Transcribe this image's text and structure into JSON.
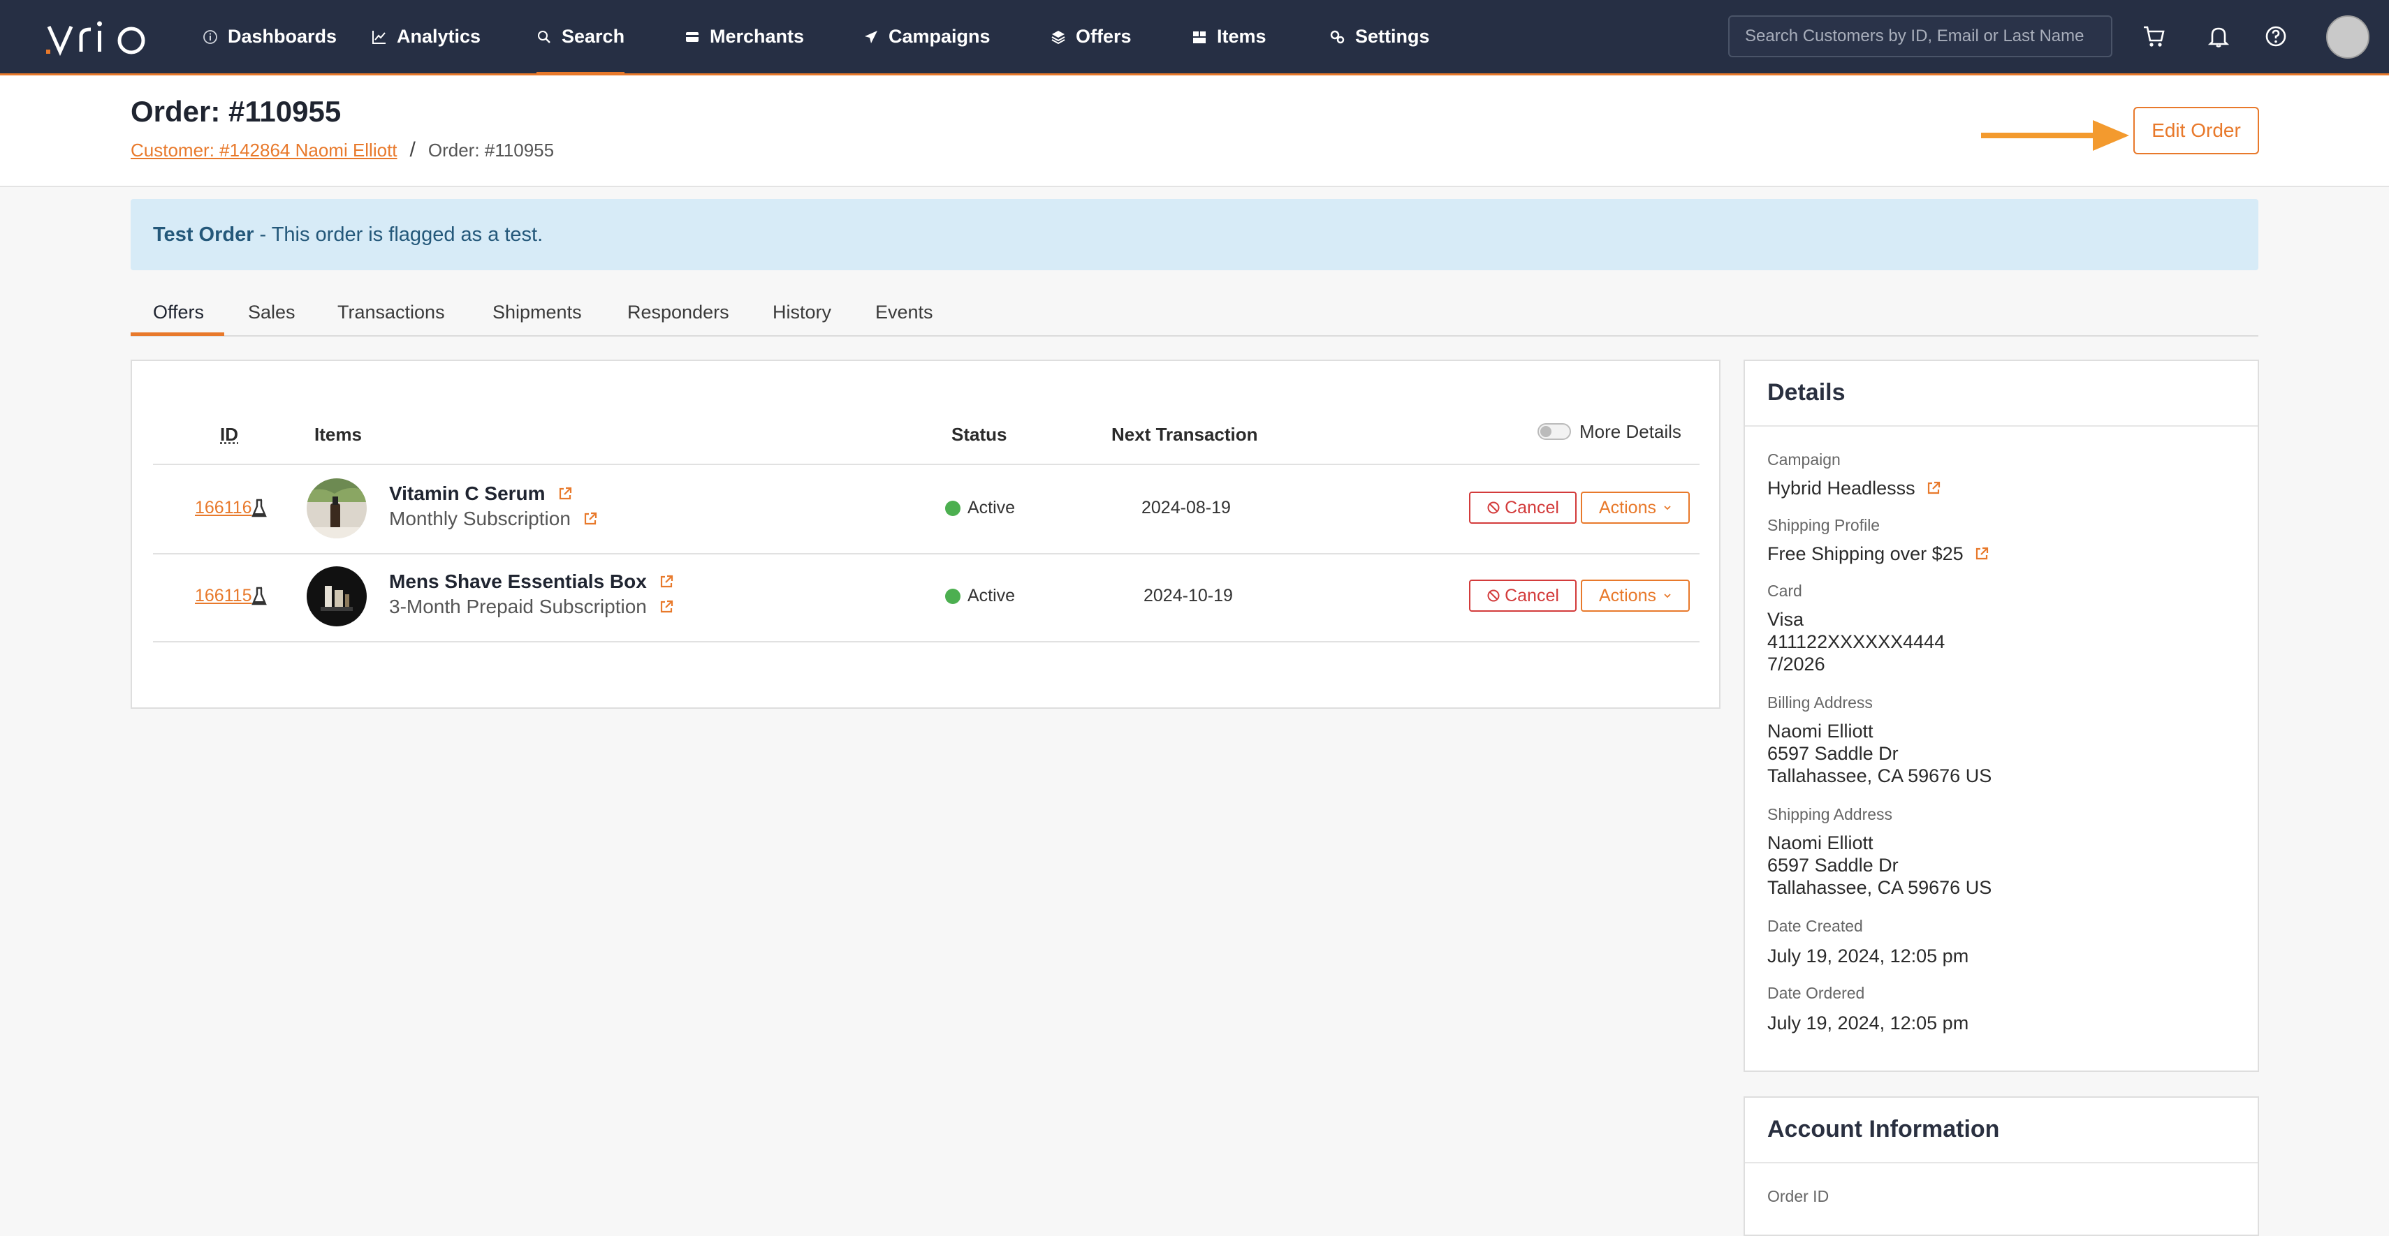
{
  "nav": {
    "logo": "vrio",
    "items": [
      {
        "label": "Dashboards",
        "icon": "info-circle-icon"
      },
      {
        "label": "Analytics",
        "icon": "line-chart-icon"
      },
      {
        "label": "Search",
        "icon": "search-icon"
      },
      {
        "label": "Merchants",
        "icon": "credit-card-icon"
      },
      {
        "label": "Campaigns",
        "icon": "send-icon"
      },
      {
        "label": "Offers",
        "icon": "layers-icon"
      },
      {
        "label": "Items",
        "icon": "boxes-icon"
      },
      {
        "label": "Settings",
        "icon": "cogs-icon"
      }
    ],
    "active": "Search",
    "search_placeholder": "Search Customers by ID, Email or Last Name"
  },
  "header": {
    "title": "Order: #110955",
    "breadcrumb_customer": "Customer: #142864 Naomi Elliott",
    "breadcrumb_sep": "/",
    "breadcrumb_order": "Order: #110955",
    "edit_button": "Edit Order"
  },
  "alert": {
    "bold": "Test Order",
    "text": "- This order is flagged as a test."
  },
  "tabs": [
    "Offers",
    "Sales",
    "Transactions",
    "Shipments",
    "Responders",
    "History",
    "Events"
  ],
  "offers_table": {
    "headers": {
      "id": "ID",
      "items": "Items",
      "status": "Status",
      "next": "Next Transaction"
    },
    "more_details": "More Details",
    "rows": [
      {
        "id": "166116",
        "name": "Vitamin C Serum",
        "plan": "Monthly Subscription",
        "status": "Active",
        "next": "2024-08-19",
        "cancel": "Cancel",
        "actions": "Actions"
      },
      {
        "id": "166115",
        "name": "Mens Shave Essentials Box",
        "plan": "3-Month Prepaid Subscription",
        "status": "Active",
        "next": "2024-10-19",
        "cancel": "Cancel",
        "actions": "Actions"
      }
    ]
  },
  "details": {
    "title": "Details",
    "campaign_label": "Campaign",
    "campaign": "Hybrid Headlesss",
    "shipping_profile_label": "Shipping Profile",
    "shipping_profile": "Free Shipping over $25",
    "card_label": "Card",
    "card_type": "Visa",
    "card_number": "411122XXXXXX4444",
    "card_exp": "7/2026",
    "billing_label": "Billing Address",
    "billing_name": "Naomi Elliott",
    "billing_street": "6597 Saddle Dr",
    "billing_city": "Tallahassee, CA 59676 US",
    "shipping_label": "Shipping Address",
    "shipping_name": "Naomi Elliott",
    "shipping_street": "6597 Saddle Dr",
    "shipping_city": "Tallahassee, CA 59676 US",
    "created_label": "Date Created",
    "created": "July 19, 2024, 12:05 pm",
    "ordered_label": "Date Ordered",
    "ordered": "July 19, 2024, 12:05 pm"
  },
  "account": {
    "title": "Account Information",
    "order_id_label": "Order ID"
  },
  "colors": {
    "accent": "#e8792b",
    "nav": "#262f44",
    "alert_bg": "#d7ebf7",
    "danger": "#d33b3b",
    "success": "#4caf50"
  }
}
